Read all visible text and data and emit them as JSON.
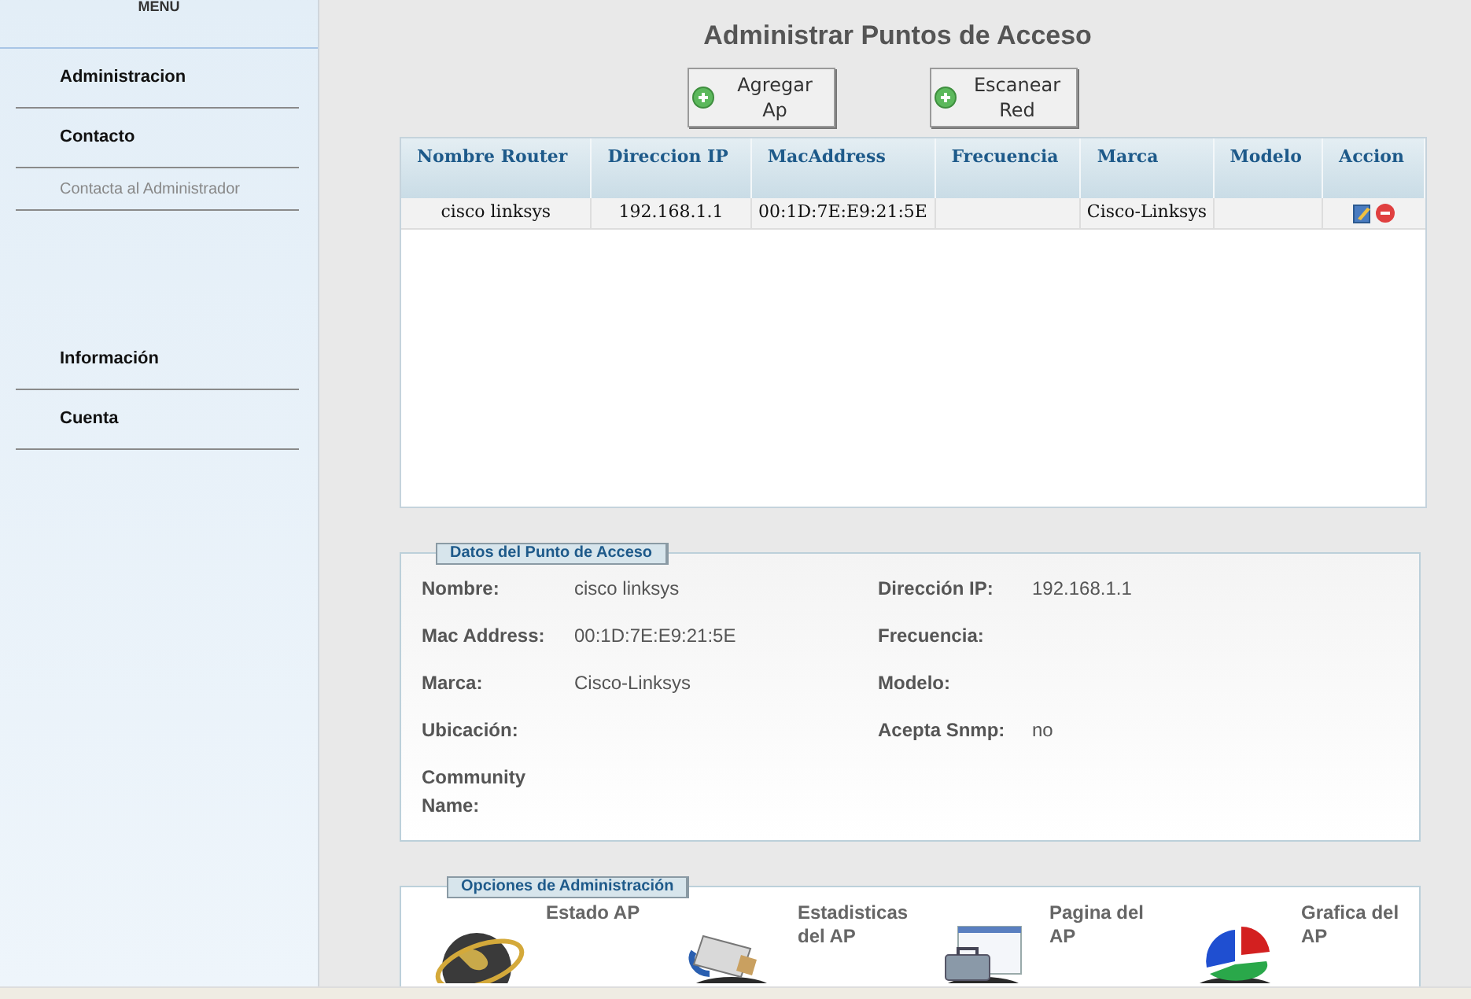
{
  "sidebar": {
    "title": "MENU",
    "items": [
      {
        "label": "Administracion",
        "kind": "section"
      },
      {
        "label": "Contacto",
        "kind": "section"
      },
      {
        "label": "Contacta al Administrador",
        "kind": "link"
      },
      {
        "label": "Información",
        "kind": "section"
      },
      {
        "label": "Cuenta",
        "kind": "section"
      }
    ]
  },
  "page_title": "Administrar Puntos de Acceso",
  "buttons": [
    {
      "label": "Agregar Ap"
    },
    {
      "label": "Escanear Red"
    }
  ],
  "table": {
    "columns": [
      "Nombre Router",
      "Direccion IP",
      "MacAddress",
      "Frecuencia",
      "Marca",
      "Modelo",
      "Accion"
    ],
    "rows": [
      {
        "cells": [
          "cisco linksys",
          "192.168.1.1",
          "00:1D:7E:E9:21:5E",
          "",
          "Cisco-Linksys",
          ""
        ]
      }
    ]
  },
  "details": {
    "legend": "Datos del Punto de Acceso",
    "fields": [
      {
        "label": "Nombre:",
        "value": "cisco linksys"
      },
      {
        "label": "Dirección IP:",
        "value": "192.168.1.1"
      },
      {
        "label": "Mac Address:",
        "value": "00:1D:7E:E9:21:5E"
      },
      {
        "label": "Frecuencia:"
      },
      {
        "label": "Marca:",
        "value": "Cisco-Linksys"
      },
      {
        "label": "Modelo:"
      },
      {
        "label": "Ubicación:"
      },
      {
        "label": "Acepta Snmp:",
        "value": "no"
      },
      {
        "label": "Community Name:"
      }
    ]
  },
  "options": {
    "legend": "Opciones de Administración",
    "items": [
      {
        "label": "Estado AP",
        "kind": "globe"
      },
      {
        "label": "Estadisticas del AP",
        "kind": "cable"
      },
      {
        "label": "Pagina del AP",
        "kind": "toolbox"
      },
      {
        "label": "Grafica del AP",
        "kind": "chart"
      }
    ]
  }
}
